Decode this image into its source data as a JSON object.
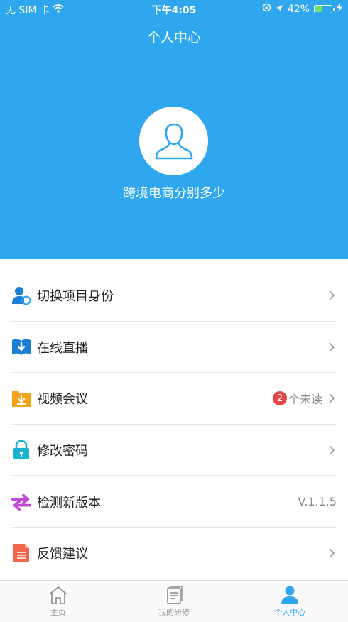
{
  "status_bar": {
    "carrier": "无 SIM 卡",
    "time": "下午4:05",
    "battery_percent": "42%",
    "battery_level": 0.42
  },
  "header": {
    "title": "个人中心",
    "username": "跨境电商分别多少"
  },
  "menu": {
    "items": [
      {
        "label": "切换项目身份",
        "icon": "user-switch-icon"
      },
      {
        "label": "在线直播",
        "icon": "live-book-icon"
      },
      {
        "label": "视频会议",
        "icon": "download-folder-icon",
        "badge": "2",
        "unread_text": "个未读"
      },
      {
        "label": "修改密码",
        "icon": "lock-icon"
      },
      {
        "label": "检测新版本",
        "icon": "update-arrows-icon",
        "version": "V.1.1.5"
      },
      {
        "label": "反馈建议",
        "icon": "document-icon"
      }
    ]
  },
  "tabbar": {
    "tabs": [
      {
        "label": "主页",
        "icon": "home-icon",
        "active": false
      },
      {
        "label": "我的研修",
        "icon": "notes-icon",
        "active": false
      },
      {
        "label": "个人中心",
        "icon": "person-icon",
        "active": true
      }
    ]
  },
  "colors": {
    "primary": "#2ea7ee",
    "badge": "#e54545"
  }
}
